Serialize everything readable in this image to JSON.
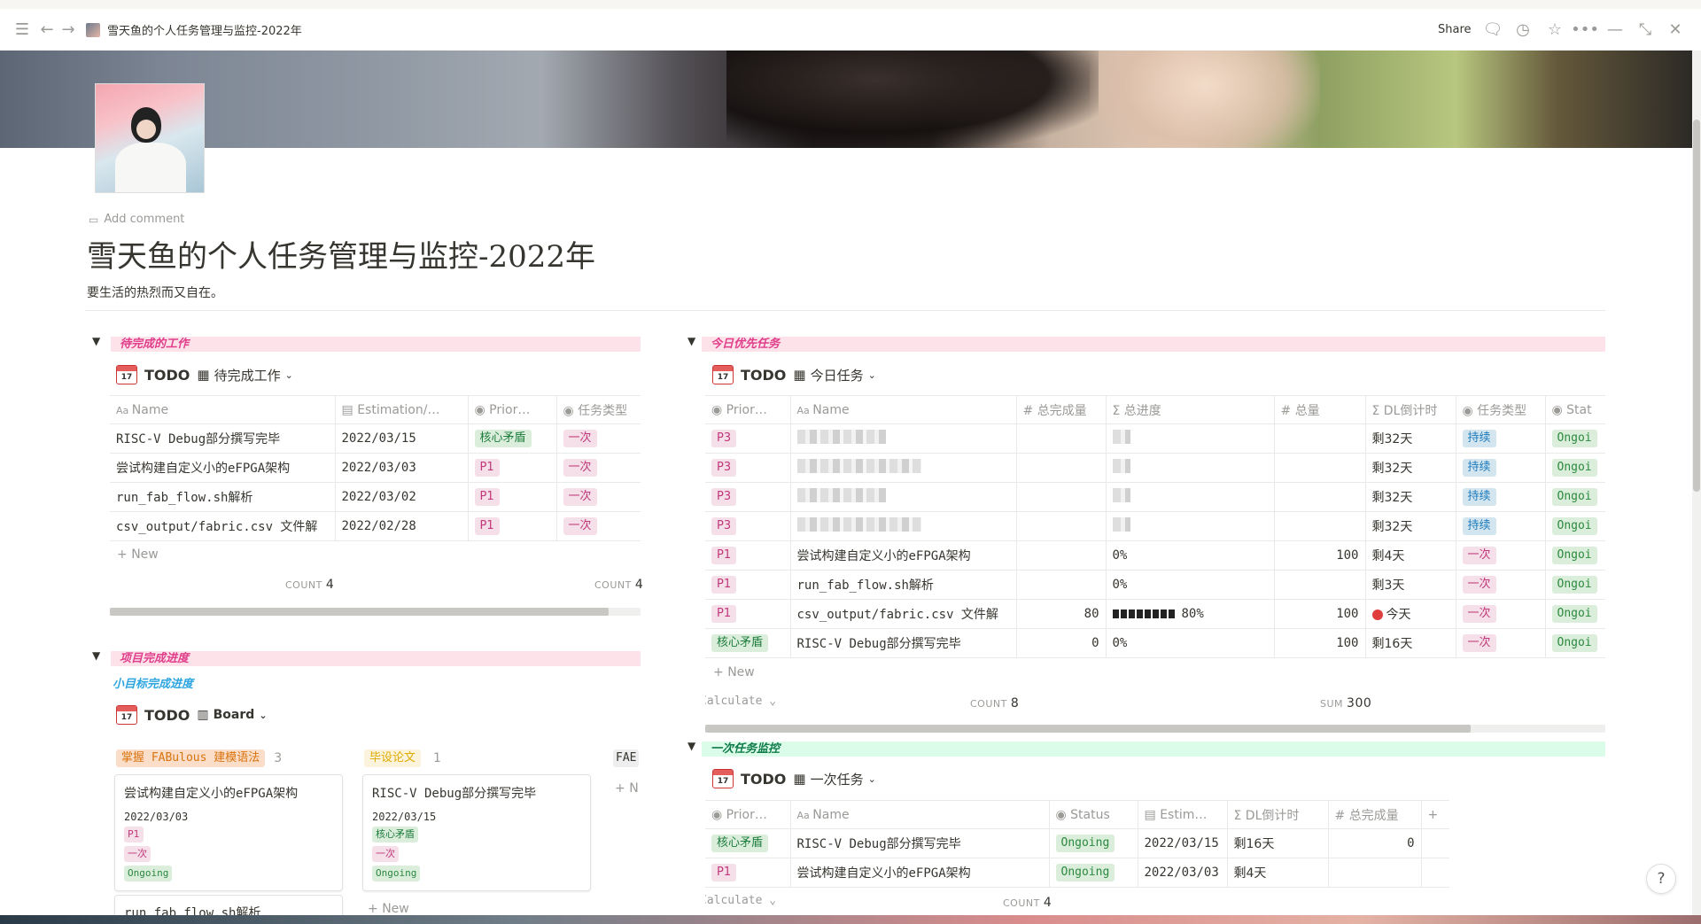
{
  "nav": {
    "page_title": "雪天鱼的个人任务管理与监控-2022年",
    "share_label": "Share"
  },
  "page": {
    "add_comment": "Add comment",
    "title": "雪天鱼的个人任务管理与监控-2022年",
    "subtitle": "要生活的热烈而又自在。"
  },
  "left": {
    "section1_title": "待完成的工作",
    "db1": {
      "db_name": "TODO",
      "view_name": "待完成工作",
      "columns": [
        "Name",
        "Estimation/…",
        "Prior…",
        "任务类型"
      ],
      "rows": [
        {
          "name": "RISC-V Debug部分撰写完毕",
          "date": "2022/03/15",
          "prio": "核心矛盾",
          "type": "一次"
        },
        {
          "name": "尝试构建自定义小的eFPGA架构",
          "date": "2022/03/03",
          "prio": "P1",
          "type": "一次"
        },
        {
          "name": "run_fab_flow.sh解析",
          "date": "2022/03/02",
          "prio": "P1",
          "type": "一次"
        },
        {
          "name": "csv_output/fabric.csv 文件解",
          "date": "2022/02/28",
          "prio": "P1",
          "type": "一次"
        }
      ],
      "new_label": "New",
      "count_label": "COUNT",
      "count_a": "4",
      "count_b": "4"
    },
    "section2_title": "项目完成进度",
    "section2_sub": "小目标完成进度",
    "board": {
      "db_name": "TODO",
      "view_name": "Board",
      "groups": [
        {
          "name": "掌握 FABulous 建模语法",
          "count": "3"
        },
        {
          "name": "毕设论文",
          "count": "1"
        },
        {
          "name": "FAE",
          "count": ""
        }
      ],
      "cards": [
        {
          "title": "尝试构建自定义小的eFPGA架构",
          "date": "2022/03/03",
          "prio": "P1",
          "type": "一次",
          "status": "Ongoing"
        },
        {
          "title": "RISC-V Debug部分撰写完毕",
          "date": "2022/03/15",
          "prio": "核心矛盾",
          "type": "一次",
          "status": "Ongoing"
        }
      ],
      "next_card_title": "run_fab_flow.sh解析",
      "new_label": "New",
      "n_label": "N"
    }
  },
  "right": {
    "section1_title": "今日优先任务",
    "db1": {
      "db_name": "TODO",
      "view_name": "今日任务",
      "columns": [
        "Prior…",
        "Name",
        "总完成量",
        "总进度",
        "总量",
        "DL倒计时",
        "任务类型",
        "Stat"
      ],
      "rows": [
        {
          "prio": "P3",
          "name": "",
          "done": "",
          "progress": "",
          "total": "",
          "dl": "剩32天",
          "type": "持续",
          "status": "Ongoi"
        },
        {
          "prio": "P3",
          "name": "",
          "done": "",
          "progress": "",
          "total": "",
          "dl": "剩32天",
          "type": "持续",
          "status": "Ongoi"
        },
        {
          "prio": "P3",
          "name": "",
          "done": "",
          "progress": "",
          "total": "",
          "dl": "剩32天",
          "type": "持续",
          "status": "Ongoi"
        },
        {
          "prio": "P3",
          "name": "",
          "done": "",
          "progress": "",
          "total": "",
          "dl": "剩32天",
          "type": "持续",
          "status": "Ongoi"
        },
        {
          "prio": "P1",
          "name": "尝试构建自定义小的eFPGA架构",
          "done": "",
          "progress": "0%",
          "total": "100",
          "dl": "剩4天",
          "type": "一次",
          "status": "Ongoi"
        },
        {
          "prio": "P1",
          "name": "run_fab_flow.sh解析",
          "done": "",
          "progress": "0%",
          "total": "",
          "dl": "剩3天",
          "type": "一次",
          "status": "Ongoi"
        },
        {
          "prio": "P1",
          "name": "csv_output/fabric.csv 文件解",
          "done": "80",
          "progress": "80%",
          "total": "100",
          "dl": "今天",
          "type": "一次",
          "status": "Ongoi"
        },
        {
          "prio": "核心矛盾",
          "name": "RISC-V Debug部分撰写完毕",
          "done": "0",
          "progress": "0%",
          "total": "100",
          "dl": "剩16天",
          "type": "一次",
          "status": "Ongoi"
        }
      ],
      "progress_fraction_row7": 0.8,
      "new_label": "New",
      "calculate_label": "Calculate",
      "count_label": "COUNT",
      "count": "8",
      "sum_label": "SUM",
      "sum": "300"
    },
    "section2_title": "一次任务监控",
    "db2": {
      "db_name": "TODO",
      "view_name": "一次任务",
      "columns": [
        "Prior…",
        "Name",
        "Status",
        "Estim…",
        "DL倒计时",
        "总完成量"
      ],
      "rows": [
        {
          "prio": "核心矛盾",
          "name": "RISC-V Debug部分撰写完毕",
          "status": "Ongoing",
          "date": "2022/03/15",
          "dl": "剩16天",
          "done": "0"
        },
        {
          "prio": "P1",
          "name": "尝试构建自定义小的eFPGA架构",
          "status": "Ongoing",
          "date": "2022/03/03",
          "dl": "剩4天",
          "done": ""
        }
      ],
      "calculate_label": "Calculate",
      "count_label": "COUNT",
      "count": "4"
    }
  },
  "help_label": "?"
}
